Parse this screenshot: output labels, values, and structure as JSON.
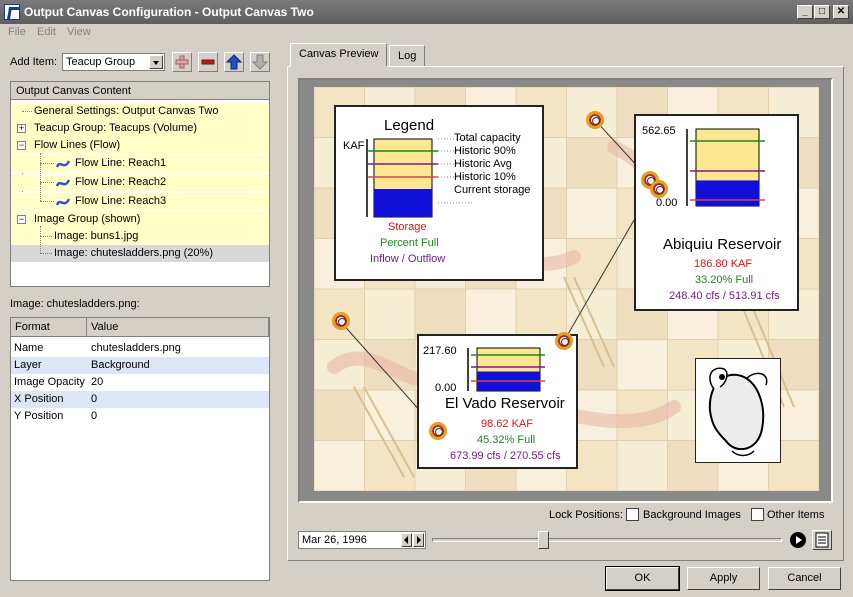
{
  "window": {
    "title": "Output Canvas Configuration - Output Canvas Two",
    "minimize_glyph": "_",
    "maximize_glyph": "□",
    "close_glyph": "✕"
  },
  "menu": [
    "File",
    "Edit",
    "View"
  ],
  "add_item": {
    "label": "Add Item:",
    "selected": "Teacup Group"
  },
  "content_panel": {
    "header": "Output Canvas Content",
    "items": [
      {
        "label": "General Settings: Output Canvas Two"
      },
      {
        "label": "Teacup Group: Teacups (Volume)"
      },
      {
        "label": "Flow Lines (Flow)"
      },
      {
        "label": "Flow Line: Reach1"
      },
      {
        "label": "Flow Line: Reach2"
      },
      {
        "label": "Flow Line: Reach3"
      },
      {
        "label": "Image Group (shown)"
      },
      {
        "label": "Image: buns1.jpg"
      },
      {
        "label": "Image: chutesladders.png (20%)"
      }
    ]
  },
  "properties": {
    "heading": "Image: chutesladders.png:",
    "columns": [
      "Format",
      "Value"
    ],
    "rows": [
      {
        "name": "Name",
        "value": "chutesladders.png"
      },
      {
        "name": "Layer",
        "value": "Background"
      },
      {
        "name": "Image Opacity",
        "value": "20"
      },
      {
        "name": "X Position",
        "value": "0"
      },
      {
        "name": "Y Position",
        "value": "0"
      }
    ]
  },
  "tabs": [
    "Canvas Preview",
    "Log"
  ],
  "legend": {
    "title": "Legend",
    "unit": "KAF",
    "lines": [
      "Total capacity",
      "Historic 90%",
      "Historic Avg",
      "Historic 10%",
      "Current storage"
    ],
    "storage": "Storage",
    "percent_full": "Percent Full",
    "inflow_outflow": "Inflow / Outflow"
  },
  "reservoirs": [
    {
      "name": "Abiquiu Reservoir",
      "max_label": "562.65",
      "min_label": "0.00",
      "storage": "186.80 KAF",
      "percent": "33.20% Full",
      "flow": "248.40 cfs / 513.91 cfs",
      "fill_fraction": 0.332
    },
    {
      "name": "El Vado Reservoir",
      "max_label": "217.60",
      "min_label": "0.00",
      "storage": "98.62 KAF",
      "percent": "45.32% Full",
      "flow": "673.99 cfs / 270.55 cfs",
      "fill_fraction": 0.4532
    }
  ],
  "colors": {
    "storage_red": "#e01010",
    "percent_green": "#1a8a1a",
    "flow_purple": "#7a1a8a",
    "current_storage_blue": "#1010d8",
    "capacity_yellow": "#ffe690"
  },
  "lock": {
    "label": "Lock Positions:",
    "background_images": "Background Images",
    "other_items": "Other Items"
  },
  "timeline": {
    "date": "Mar 26, 1996"
  },
  "buttons": {
    "ok": "OK",
    "apply": "Apply",
    "cancel": "Cancel"
  }
}
